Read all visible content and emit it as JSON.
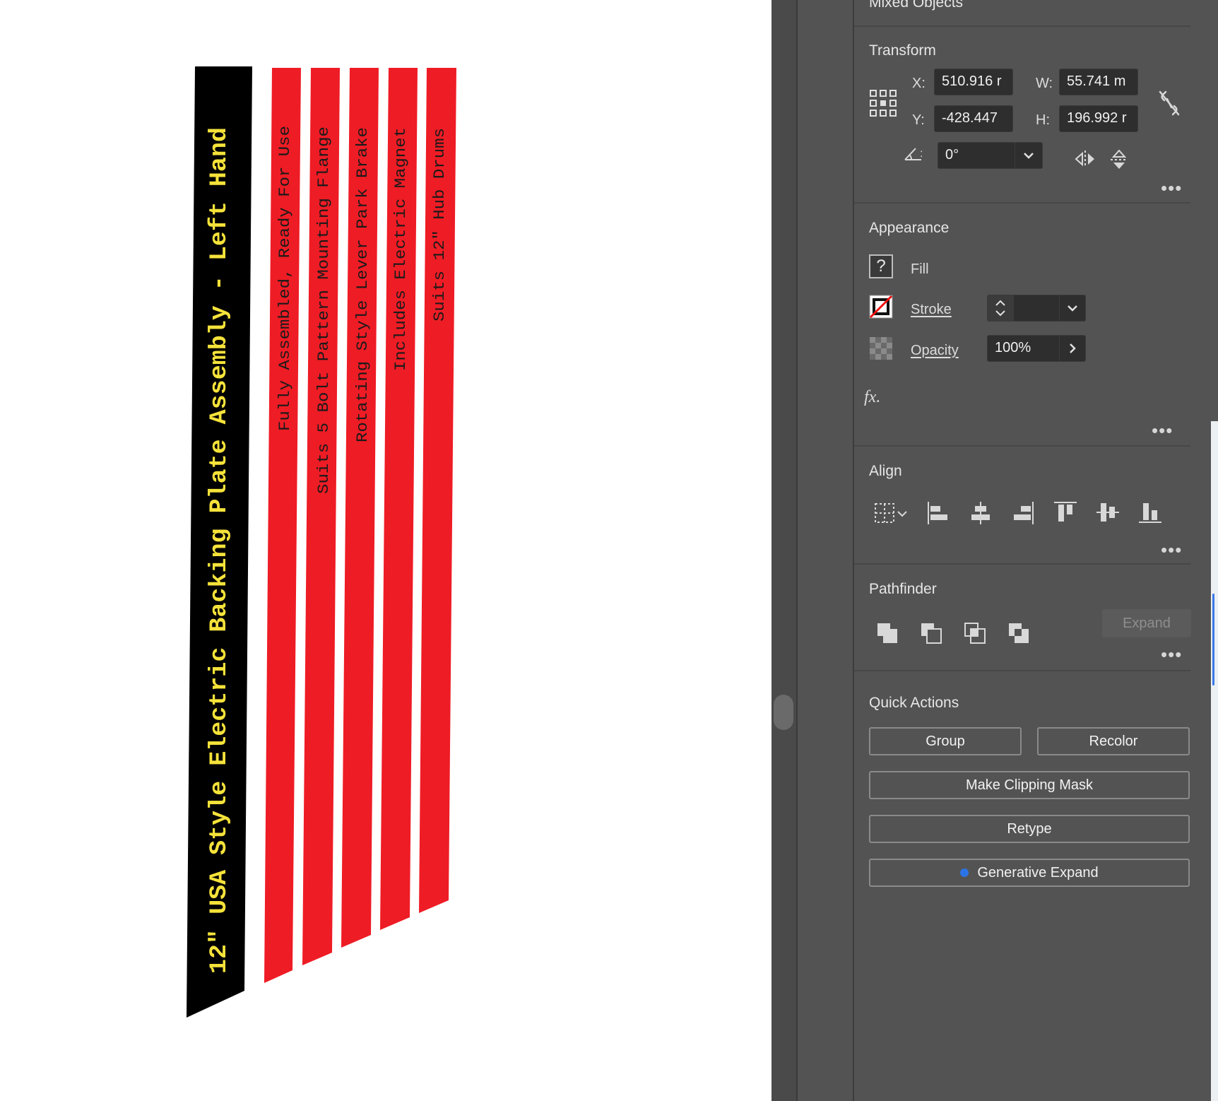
{
  "artboard": {
    "black_strip": {
      "text": "12\" USA Style Electric Backing Plate Assembly - Left Hand",
      "fill": "#000000",
      "text_color": "#f5e23a"
    },
    "red_strips": [
      {
        "text": "Fully Assembled, Ready For Use"
      },
      {
        "text": "Suits 5 Bolt Pattern Mounting Flange"
      },
      {
        "text": "Rotating Style Lever Park Brake"
      },
      {
        "text": "Includes Electric Magnet"
      },
      {
        "text": "Suits 12\" Hub Drums"
      }
    ],
    "red_fill": "#ee1c25",
    "red_text_color": "#1a1a1a"
  },
  "panel": {
    "header": "Mixed Objects",
    "transform": {
      "title": "Transform",
      "x_label": "X:",
      "x_value": "510.916 r",
      "y_label": "Y:",
      "y_value": "-428.447",
      "w_label": "W:",
      "w_value": "55.741 m",
      "h_label": "H:",
      "h_value": "196.992 r",
      "angle_value": "0°"
    },
    "appearance": {
      "title": "Appearance",
      "fill_label": "Fill",
      "fill_swatch": "?",
      "stroke_label": "Stroke",
      "opacity_label": "Opacity",
      "opacity_value": "100%",
      "fx_label": "fx."
    },
    "align": {
      "title": "Align"
    },
    "pathfinder": {
      "title": "Pathfinder",
      "expand_label": "Expand"
    },
    "quick_actions": {
      "title": "Quick Actions",
      "group": "Group",
      "recolor": "Recolor",
      "clipping_mask": "Make Clipping Mask",
      "retype": "Retype",
      "generative_expand": "Generative Expand"
    }
  }
}
